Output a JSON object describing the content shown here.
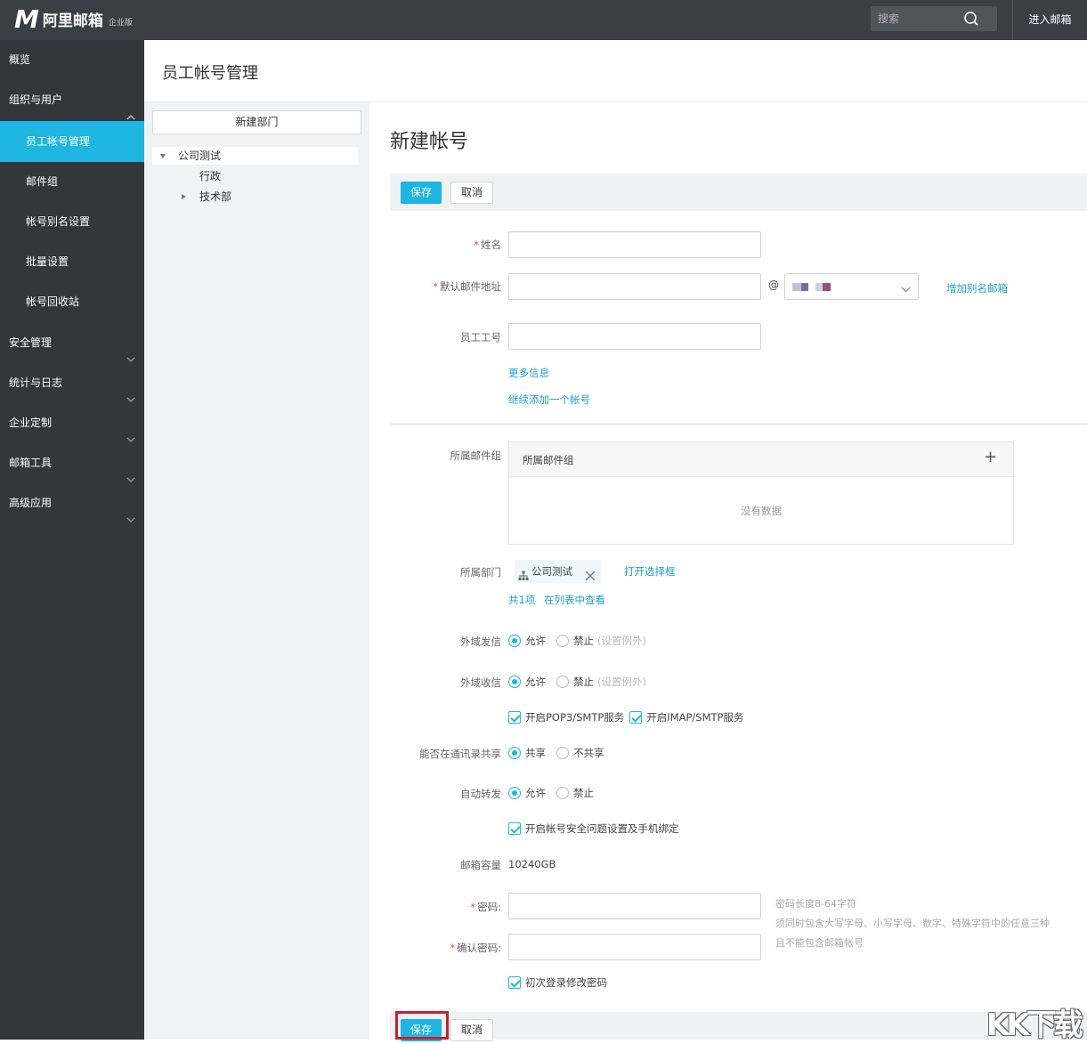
{
  "header": {
    "logo_mark": "M",
    "logo_name": "阿里邮箱",
    "logo_edition": "企业版",
    "search_placeholder": "搜索",
    "enter_mail": "进入邮箱"
  },
  "sidebar": {
    "items": [
      {
        "label": "概览"
      },
      {
        "label": "组织与用户"
      },
      {
        "label": "员工帐号管理"
      },
      {
        "label": "邮件组"
      },
      {
        "label": "帐号别名设置"
      },
      {
        "label": "批量设置"
      },
      {
        "label": "帐号回收站"
      },
      {
        "label": "安全管理"
      },
      {
        "label": "统计与日志"
      },
      {
        "label": "企业定制"
      },
      {
        "label": "邮箱工具"
      },
      {
        "label": "高级应用"
      }
    ]
  },
  "page": {
    "title": "员工帐号管理"
  },
  "tree": {
    "new_department": "新建部门",
    "nodes": [
      {
        "label": "公司测试"
      },
      {
        "label": "行政"
      },
      {
        "label": "技术部"
      }
    ]
  },
  "form": {
    "title": "新建帐号",
    "save": "保存",
    "cancel": "取消",
    "required_mark": "*",
    "name_label": "姓名",
    "email_label": "默认邮件地址",
    "at": "@",
    "add_alias": "增加别名邮箱",
    "employee_id_label": "员工工号",
    "more_info": "更多信息",
    "continue_add": "继续添加一个帐号",
    "mail_group_label": "所属邮件组",
    "mail_group_header": "所属邮件组",
    "mail_group_add": "+",
    "no_data": "没有数据",
    "department_label": "所属部门",
    "department_tag": "公司测试",
    "open_selector": "打开选择框",
    "count": "共1项",
    "view_in_list": "在列表中查看",
    "ext_send_label": "外域发信",
    "ext_recv_label": "外域收信",
    "allow": "允许",
    "deny": "禁止",
    "set_exception": "(设置例外)",
    "pop3_service": "开启POP3/SMTP服务",
    "imap_service": "开启IMAP/SMTP服务",
    "share_label": "能否在通讯录共享",
    "share": "共享",
    "no_share": "不共享",
    "forward_label": "自动转发",
    "security_bind": "开启帐号安全问题设置及手机绑定",
    "capacity_label": "邮箱容量",
    "capacity_value": "10240GB",
    "password_label": "密码:",
    "confirm_label": "确认密码:",
    "pwd_hint_1": "密码长度8-64字符",
    "pwd_hint_2": "须同时包含大写字母、小写字母、数字、特殊字符中的任意三种",
    "pwd_hint_3": "且不能包含邮箱帐号",
    "first_login_change": "初次登录修改密码"
  },
  "watermark": "KK下载",
  "colors": {
    "accent": "#1eb5e0",
    "sidebar": "#33363b",
    "topbar": "#3b3f45",
    "highlight": "#c8202b"
  }
}
